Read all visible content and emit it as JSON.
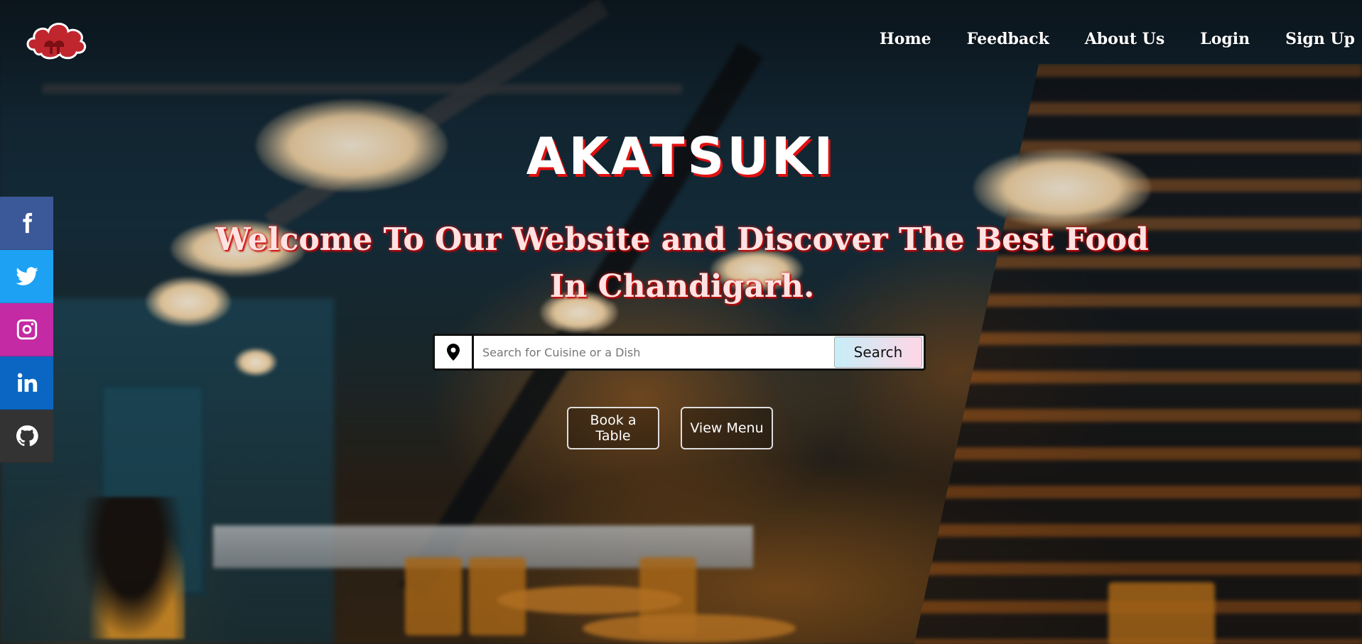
{
  "brand": {
    "logo_icon": "akatsuki-cloud-icon",
    "title": "AKATSUKI",
    "title_shadow_color": "#e01010"
  },
  "nav": {
    "items": [
      {
        "label": "Home"
      },
      {
        "label": "Feedback"
      },
      {
        "label": "About Us"
      },
      {
        "label": "Login"
      },
      {
        "label": "Sign Up"
      }
    ]
  },
  "social": {
    "items": [
      {
        "icon": "facebook-icon",
        "color": "#3b5998"
      },
      {
        "icon": "twitter-icon",
        "color": "#1da1f2"
      },
      {
        "icon": "instagram-icon",
        "color": "#c32aa3"
      },
      {
        "icon": "linkedin-icon",
        "color": "#0a66c2"
      },
      {
        "icon": "github-icon",
        "color": "#333333"
      }
    ]
  },
  "hero": {
    "subtitle": "Welcome To Our Website and Discover The Best Food In Chandigarh."
  },
  "search": {
    "location_icon": "map-pin-icon",
    "placeholder": "Search for Cuisine or a Dish",
    "value": "",
    "button_label": "Search"
  },
  "actions": {
    "book_label": "Book a Table",
    "menu_label": "View Menu"
  }
}
